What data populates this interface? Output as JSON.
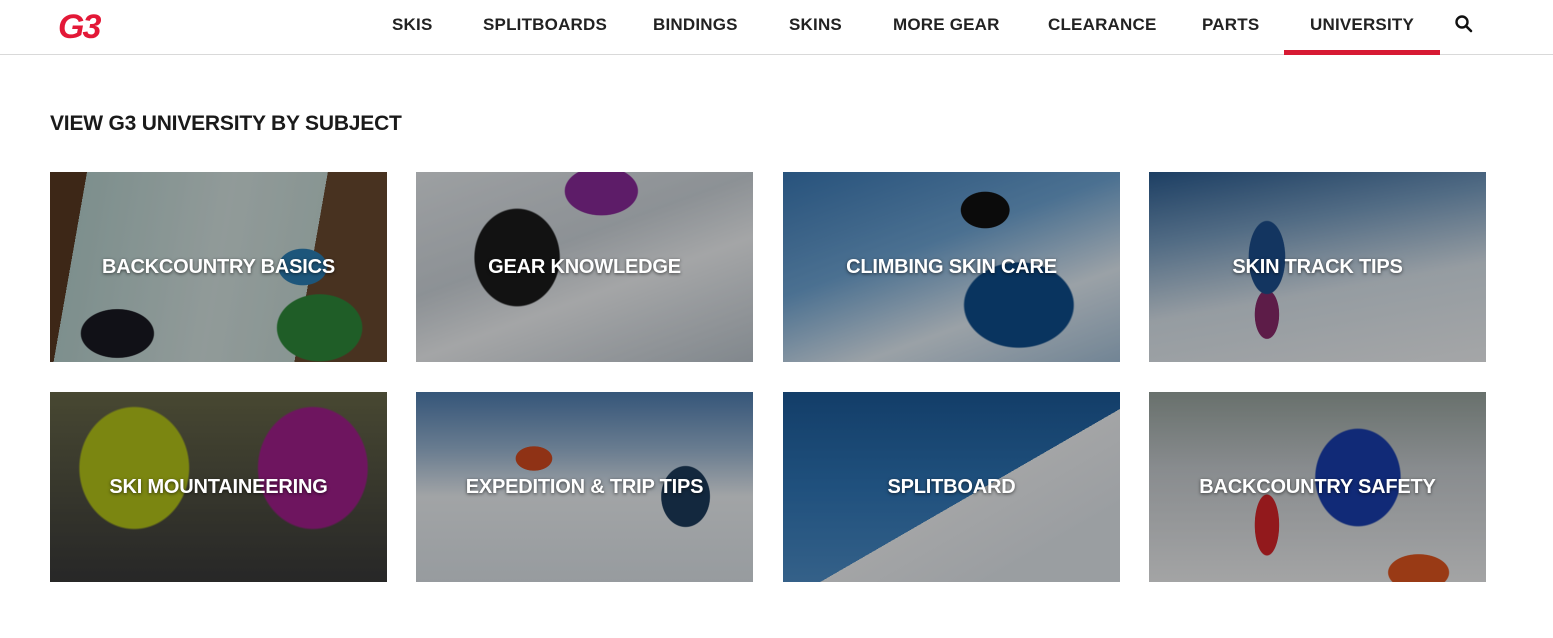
{
  "brand": {
    "logo_text": "G3",
    "accent_color": "#d71a33"
  },
  "nav": {
    "items": [
      {
        "label": "SKIS"
      },
      {
        "label": "SPLITBOARDS"
      },
      {
        "label": "BINDINGS"
      },
      {
        "label": "SKINS"
      },
      {
        "label": "MORE GEAR"
      },
      {
        "label": "CLEARANCE"
      },
      {
        "label": "PARTS"
      },
      {
        "label": "UNIVERSITY",
        "active": true
      }
    ],
    "search_icon": "search-icon"
  },
  "main": {
    "section_title": "VIEW G3 UNIVERSITY BY SUBJECT",
    "subjects": [
      {
        "label": "BACKCOUNTRY BASICS"
      },
      {
        "label": "GEAR KNOWLEDGE"
      },
      {
        "label": "CLIMBING SKIN CARE"
      },
      {
        "label": "SKIN TRACK TIPS"
      },
      {
        "label": "SKI MOUNTAINEERING"
      },
      {
        "label": "EXPEDITION & TRIP TIPS"
      },
      {
        "label": "SPLITBOARD"
      },
      {
        "label": "BACKCOUNTRY SAFETY"
      }
    ]
  }
}
